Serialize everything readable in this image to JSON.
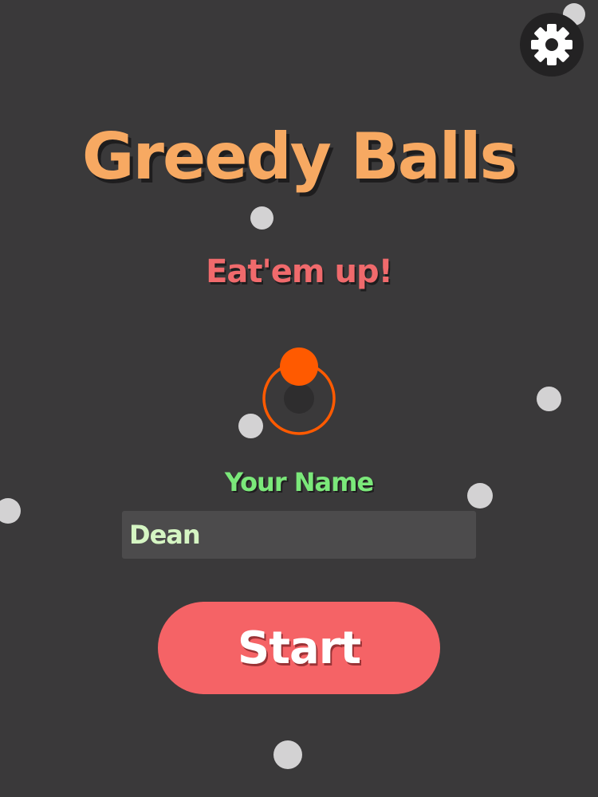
{
  "game": {
    "title": "Greedy Balls",
    "subtitle": "Eat'em up!"
  },
  "form": {
    "name_label": "Your Name",
    "name_value": "Dean"
  },
  "start_button": {
    "label": "Start"
  },
  "icons": {
    "settings": "gear-icon",
    "player": "player-ball-icon"
  },
  "colors": {
    "background": "#3a393a",
    "title": "#f7a962",
    "subtitle": "#f06a6c",
    "name_label": "#7be87a",
    "input_text": "#d5f5c3",
    "start_button": "#f56366",
    "player_ball": "#ff5a00",
    "pellet": "#d3d2d3"
  }
}
